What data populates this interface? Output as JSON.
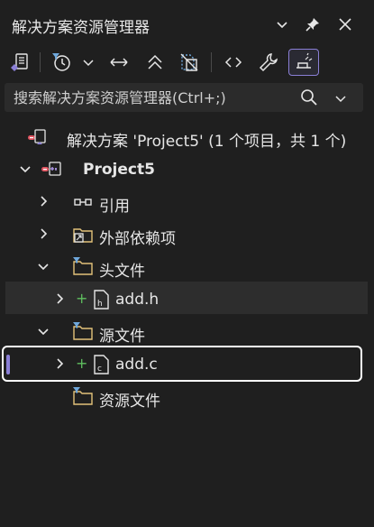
{
  "window": {
    "title": "解决方案资源管理器"
  },
  "search": {
    "placeholder": "搜索解决方案资源管理器(Ctrl+;)"
  },
  "tree": {
    "solution": "解决方案 'Project5' (1 个项目，共 1 个)",
    "project": "Project5",
    "references": "引用",
    "external_deps": "外部依赖项",
    "header_files": "头文件",
    "header_file_1": "add.h",
    "source_files": "源文件",
    "source_file_1": "add.c",
    "resource_files": "资源文件",
    "added_marker": "+"
  },
  "icons": [
    "chevron-down-icon",
    "pin-icon",
    "close-icon",
    "vs-switch-views-icon",
    "pending-changes-filter-icon",
    "sync-icon",
    "collapse-all-icon",
    "show-all-files-icon",
    "code-view-icon",
    "properties-wrench-icon",
    "preview-selected-icon",
    "search-icon"
  ],
  "colors": {
    "background": "#1f1f1f",
    "accent": "#8a7fd6",
    "folder": "#e3c27a",
    "git_add": "#5fbf5f",
    "error_dot": "#e05561"
  }
}
